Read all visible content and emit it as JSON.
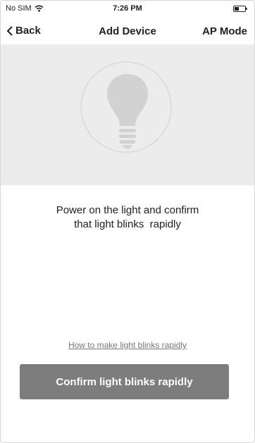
{
  "status_bar": {
    "carrier": "No SIM",
    "time": "7:26 PM",
    "icons": {
      "wifi": "wifi-icon",
      "battery": "battery-icon"
    }
  },
  "nav": {
    "back_label": "Back",
    "title": "Add Device",
    "right_action": "AP Mode",
    "icons": {
      "back": "chevron-left-icon"
    }
  },
  "hero": {
    "icon": "lightbulb-icon",
    "background": "#ececec"
  },
  "instruction": {
    "line1": "Power on the light and confirm",
    "line2": "that light blinks  rapidly"
  },
  "help_link": "How to make light blinks rapidly",
  "confirm_button": {
    "label": "Confirm light blinks rapidly",
    "color": "#7d7d7d"
  }
}
